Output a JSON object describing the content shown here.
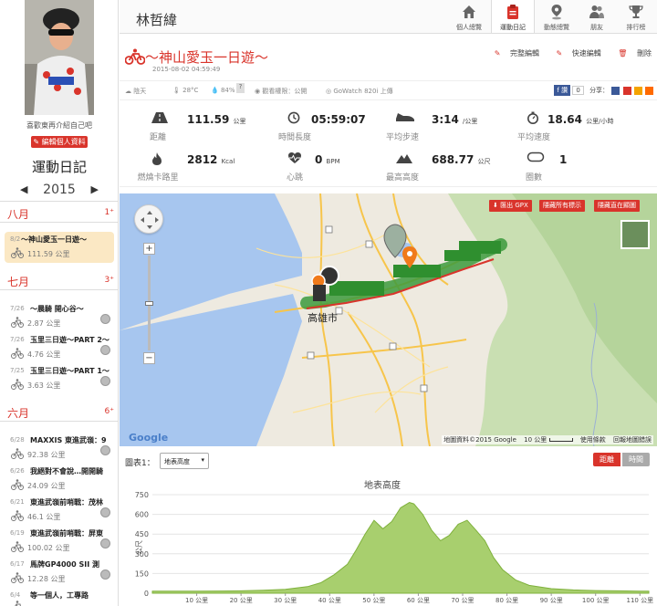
{
  "user": {
    "name": "林哲緯",
    "bio": "喜歡東再介紹自己吧",
    "edit_profile_label": "編輯個人資料"
  },
  "sidebar": {
    "title": "運動日記",
    "year": "2015",
    "months": [
      {
        "name": "八月",
        "count": "1⁺",
        "items": [
          {
            "date": "8/2",
            "title": "～神山愛玉一日遊～",
            "distance": "111.59 公里",
            "active": true
          }
        ]
      },
      {
        "name": "七月",
        "count": "3⁺",
        "items": [
          {
            "date": "7/26",
            "title": "～晨騎 開心谷～",
            "distance": "2.87 公里",
            "active": false
          },
          {
            "date": "7/26",
            "title": "玉里三日遊～PART 2～",
            "distance": "4.76 公里",
            "active": false
          },
          {
            "date": "7/25",
            "title": "玉里三日遊～PART 1～",
            "distance": "3.63 公里",
            "active": false
          }
        ]
      },
      {
        "name": "六月",
        "count": "6⁺",
        "items": [
          {
            "date": "6/28",
            "title": "MAXXIS 東進武嶺：9",
            "distance": "92.38 公里",
            "active": false
          },
          {
            "date": "6/26",
            "title": "我絕對不會說…開開騎",
            "distance": "24.09 公里",
            "active": false
          },
          {
            "date": "6/21",
            "title": "東進武嶺前哨戰：茂林",
            "distance": "46.1 公里",
            "active": false
          },
          {
            "date": "6/19",
            "title": "東進武嶺前哨戰：屏東",
            "distance": "100.02 公里",
            "active": false
          },
          {
            "date": "6/17",
            "title": "馬牌GP4000 SII 測",
            "distance": "12.28 公里",
            "active": false
          },
          {
            "date": "6/4",
            "title": "等一個人，工專路",
            "distance": "",
            "active": false
          }
        ]
      }
    ]
  },
  "nav": [
    {
      "label": "個人總覽",
      "icon": "home-icon",
      "active": false
    },
    {
      "label": "運動日記",
      "icon": "clipboard-icon",
      "active": true
    },
    {
      "label": "動態總覽",
      "icon": "location-pin-icon",
      "active": false
    },
    {
      "label": "朋友",
      "icon": "friends-icon",
      "active": false
    },
    {
      "label": "排行榜",
      "icon": "trophy-icon",
      "active": false
    }
  ],
  "activity": {
    "title": "～神山愛玉一日遊～",
    "datetime": "2015-08-02 04:59:49",
    "actions": {
      "full_edit": "完整編輯",
      "quick_edit": "快速編輯",
      "delete": "刪除"
    },
    "weather": "陰天",
    "temperature": "28°C",
    "humidity": "84%",
    "visibility": "觀看權限：公開",
    "device": "GoWatch 820i 上傳",
    "share_count": "0",
    "share_label": "分享："
  },
  "stats": [
    {
      "label": "距離",
      "value": "111.59",
      "unit": "公里",
      "icon": "road-icon"
    },
    {
      "label": "時間長度",
      "value": "05:59:07",
      "unit": "",
      "icon": "clock-icon"
    },
    {
      "label": "平均步速",
      "value": "3:14",
      "unit": "/公里",
      "icon": "shoe-icon"
    },
    {
      "label": "平均速度",
      "value": "18.64",
      "unit": "公里/小時",
      "icon": "stopwatch-icon"
    },
    {
      "label": "燃燒卡路里",
      "value": "2812",
      "unit": "Kcal",
      "icon": "flame-icon"
    },
    {
      "label": "心跳",
      "value": "0",
      "unit": "BPM",
      "icon": "heart-icon"
    },
    {
      "label": "最高高度",
      "value": "688.77",
      "unit": "公尺",
      "icon": "mountain-icon"
    },
    {
      "label": "圈數",
      "value": "1",
      "unit": "",
      "icon": "lap-icon"
    }
  ],
  "map": {
    "buttons": [
      "匯出 GPX",
      "隱藏所有標示",
      "隱藏直在顯圖"
    ],
    "city_label": "高雄市",
    "footer": {
      "data": "地圖資料©2015 Google",
      "scale": "10 公里",
      "terms": "使用條款",
      "report": "回報地圖錯誤"
    },
    "google_logo": "Google"
  },
  "chart_section": {
    "label": "圖表1：",
    "select_value": "地表高度",
    "toggle_distance": "距離",
    "toggle_time": "時間"
  },
  "colors": {
    "accent": "#d9342b",
    "chart_fill": "#a8cf6e",
    "chart_stroke": "#7fb13c",
    "route": "#3c9a3c"
  },
  "chart_data": {
    "type": "area",
    "title": "地表高度",
    "ylabel": "公尺",
    "xlabel": "",
    "ylim": [
      0,
      750
    ],
    "yticks": [
      0,
      150,
      300,
      450,
      600,
      750
    ],
    "xlim": [
      0,
      112
    ],
    "xticks": [
      10,
      20,
      30,
      40,
      50,
      60,
      70,
      80,
      90,
      100,
      110
    ],
    "xtick_suffix": " 公里",
    "series": [
      {
        "x": [
          0,
          5,
          10,
          15,
          20,
          25,
          30,
          35,
          38,
          41,
          44,
          46,
          48,
          50,
          52,
          54,
          56,
          58,
          59,
          61,
          63,
          65,
          67,
          69,
          71,
          73,
          75,
          77,
          79,
          82,
          85,
          90,
          95,
          100,
          105,
          110,
          112
        ],
        "y": [
          15,
          15,
          16,
          17,
          18,
          22,
          30,
          50,
          80,
          140,
          220,
          330,
          450,
          555,
          490,
          545,
          650,
          690,
          680,
          600,
          480,
          400,
          440,
          525,
          555,
          480,
          400,
          270,
          180,
          100,
          60,
          35,
          25,
          20,
          18,
          16,
          15
        ]
      }
    ]
  }
}
